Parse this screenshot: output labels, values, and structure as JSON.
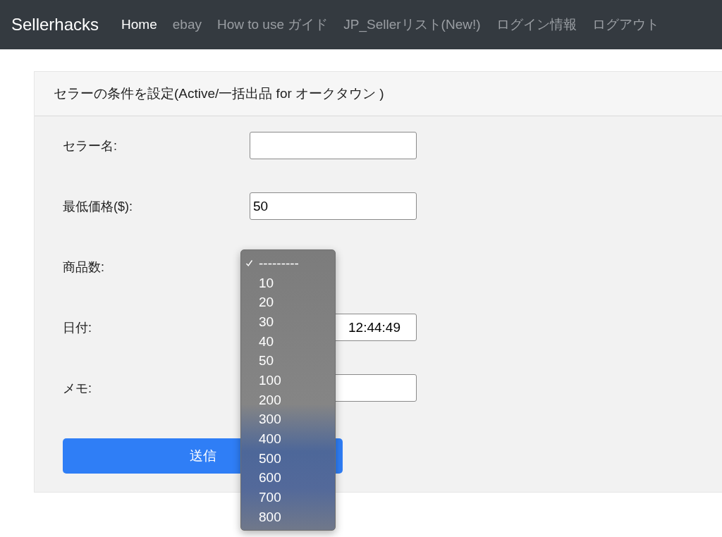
{
  "navbar": {
    "brand": "Sellerhacks",
    "items": [
      {
        "label": "Home",
        "selected": true
      },
      {
        "label": "ebay",
        "selected": false
      },
      {
        "label": "How to use ガイド",
        "selected": false
      },
      {
        "label": "JP_Sellerリスト(New!)",
        "selected": false
      },
      {
        "label": "ログイン情報",
        "selected": false
      },
      {
        "label": "ログアウト",
        "selected": false
      }
    ]
  },
  "card": {
    "title": "セラーの条件を設定(Active/一括出品 for オークタウン )",
    "fields": [
      {
        "kind": "text",
        "label": "セラー名:"
      },
      {
        "kind": "text",
        "label": "最低価格($):",
        "value": "50"
      },
      {
        "kind": "select",
        "label": "商品数:",
        "options": [
          {
            "label": "---------",
            "selected": true
          },
          {
            "label": "10",
            "selected": false
          },
          {
            "label": "20",
            "selected": false
          },
          {
            "label": "30",
            "selected": false
          },
          {
            "label": "40",
            "selected": false
          },
          {
            "label": "50",
            "selected": false
          },
          {
            "label": "100",
            "selected": false
          },
          {
            "label": "200",
            "selected": false
          },
          {
            "label": "300",
            "selected": false
          },
          {
            "label": "400",
            "selected": false
          },
          {
            "label": "500",
            "selected": false
          },
          {
            "label": "600",
            "selected": false
          },
          {
            "label": "700",
            "selected": false
          },
          {
            "label": "800",
            "selected": false
          }
        ]
      },
      {
        "kind": "datetime",
        "label": "日付:",
        "value": "12:44:49"
      },
      {
        "kind": "text",
        "label": "メモ:"
      }
    ],
    "submit": "送信"
  }
}
